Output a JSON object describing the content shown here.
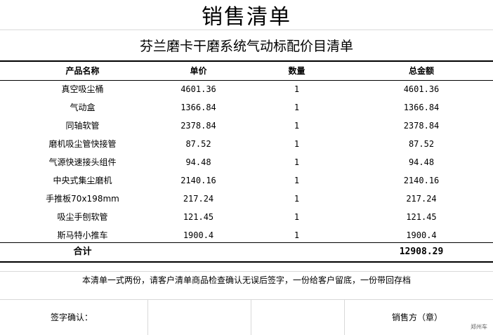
{
  "title": "销售清单",
  "subtitle": "芬兰磨卡干磨系统气动标配价目清单",
  "headers": {
    "name": "产品名称",
    "price": "单价",
    "qty": "数量",
    "total": "总金额"
  },
  "rows": [
    {
      "name": "真空吸尘桶",
      "price": "4601.36",
      "qty": "1",
      "total": "4601.36"
    },
    {
      "name": "气动盒",
      "price": "1366.84",
      "qty": "1",
      "total": "1366.84"
    },
    {
      "name": "同轴软管",
      "price": "2378.84",
      "qty": "1",
      "total": "2378.84"
    },
    {
      "name": "磨机吸尘管快接管",
      "price": "87.52",
      "qty": "1",
      "total": "87.52"
    },
    {
      "name": "气源快速接头组件",
      "price": "94.48",
      "qty": "1",
      "total": "94.48"
    },
    {
      "name": "中央式集尘磨机",
      "price": "2140.16",
      "qty": "1",
      "total": "2140.16"
    },
    {
      "name": "手推板70x198mm",
      "price": "217.24",
      "qty": "1",
      "total": "217.24"
    },
    {
      "name": "吸尘手刨软管",
      "price": "121.45",
      "qty": "1",
      "total": "121.45"
    },
    {
      "name": "斯马特小推车",
      "price": "1900.4",
      "qty": "1",
      "total": "1900.4"
    }
  ],
  "total_row": {
    "label": "合计",
    "value": "12908.29"
  },
  "note": "本清单一式两份，请客户清单商品检查确认无误后签字，一份给客户留底，一份带回存档",
  "signature": {
    "confirm_label": "签字确认：",
    "seller_label": "销售方（章）"
  },
  "watermark": "郑州车"
}
